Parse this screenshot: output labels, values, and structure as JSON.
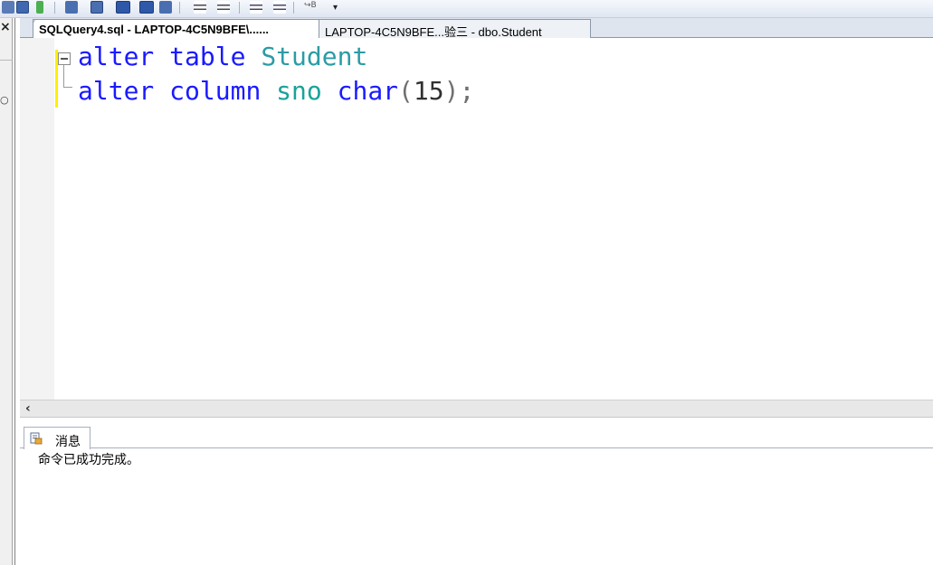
{
  "tabs": [
    {
      "label": "SQLQuery4.sql - LAPTOP-4C5N9BFE\\......",
      "active": true
    },
    {
      "label": "LAPTOP-4C5N9BFE...验三 - dbo.Student",
      "active": false
    }
  ],
  "editor": {
    "line1": {
      "kw1": "alter",
      "kw2": "table",
      "obj": "Student"
    },
    "line2": {
      "kw1": "alter",
      "kw2": "column",
      "ident": "sno",
      "type": "char",
      "open": "(",
      "num": "15",
      "close": ");"
    }
  },
  "results": {
    "tab_label": "消息",
    "message": "命令已成功完成。"
  },
  "colors": {
    "keyword": "#1a1aff",
    "object": "#2b9ca6",
    "change_bar": "#ffef00"
  }
}
